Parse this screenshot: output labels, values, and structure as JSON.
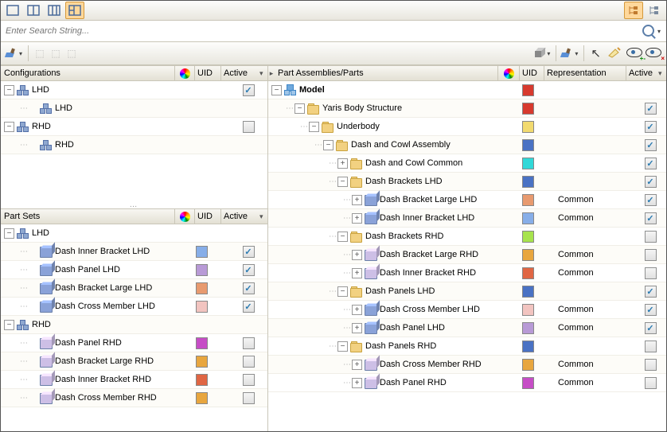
{
  "search": {
    "placeholder": "Enter Search String..."
  },
  "panes": {
    "configs": {
      "title": "Configurations",
      "uid": "UID",
      "active": "Active"
    },
    "partsets": {
      "title": "Part Sets",
      "uid": "UID",
      "active": "Active"
    },
    "assemblies": {
      "title": "Part Assemblies/Parts",
      "uid": "UID",
      "rep": "Representation",
      "active": "Active"
    }
  },
  "configs": [
    {
      "indent": 0,
      "toggle": "minus",
      "icon": "cubes",
      "label": "LHD",
      "checked": true
    },
    {
      "indent": 1,
      "toggle": "none",
      "icon": "cubes",
      "label": "LHD"
    },
    {
      "indent": 0,
      "toggle": "minus",
      "icon": "cubes",
      "label": "RHD",
      "checked": false
    },
    {
      "indent": 1,
      "toggle": "none",
      "icon": "cubes",
      "label": "RHD"
    }
  ],
  "partsets": [
    {
      "indent": 0,
      "toggle": "minus",
      "icon": "cubes",
      "label": "LHD"
    },
    {
      "indent": 1,
      "toggle": "none",
      "icon": "part",
      "pcolor": "#8aa2d8",
      "label": "Dash Inner Bracket LHD",
      "sw": "#87aee8",
      "checked": true
    },
    {
      "indent": 1,
      "toggle": "none",
      "icon": "part",
      "pcolor": "#8aa2d8",
      "label": "Dash Panel LHD",
      "sw": "#b89ad6",
      "checked": true
    },
    {
      "indent": 1,
      "toggle": "none",
      "icon": "part",
      "pcolor": "#8aa2d8",
      "label": "Dash Bracket Large LHD",
      "sw": "#e89a6f",
      "checked": true
    },
    {
      "indent": 1,
      "toggle": "none",
      "icon": "part",
      "pcolor": "#8aa2d8",
      "label": "Dash Cross Member LHD",
      "sw": "#f2c4c0",
      "checked": true
    },
    {
      "indent": 0,
      "toggle": "minus",
      "icon": "cubes",
      "label": "RHD"
    },
    {
      "indent": 1,
      "toggle": "none",
      "icon": "part",
      "pcolor": "#cdbfe6",
      "label": "Dash Panel RHD",
      "sw": "#c64dc6",
      "checked": false
    },
    {
      "indent": 1,
      "toggle": "none",
      "icon": "part",
      "pcolor": "#cdbfe6",
      "label": "Dash Bracket Large RHD",
      "sw": "#e8a63f",
      "checked": false
    },
    {
      "indent": 1,
      "toggle": "none",
      "icon": "part",
      "pcolor": "#cdbfe6",
      "label": "Dash Inner Bracket RHD",
      "sw": "#e06644",
      "checked": false
    },
    {
      "indent": 1,
      "toggle": "none",
      "icon": "part",
      "pcolor": "#cdbfe6",
      "label": "Dash Cross Member RHD",
      "sw": "#e8a63f",
      "checked": false
    }
  ],
  "assemblies": [
    {
      "indent": 0,
      "toggle": "minus",
      "icon": "model",
      "label": "Model",
      "bold": true,
      "sw": "#d73a2e"
    },
    {
      "indent": 1,
      "toggle": "minus",
      "icon": "folder",
      "label": "Yaris Body Structure",
      "sw": "#d73a2e",
      "checked": true
    },
    {
      "indent": 2,
      "toggle": "minus",
      "icon": "folder",
      "label": "Underbody",
      "sw": "#f2da6f",
      "checked": true
    },
    {
      "indent": 3,
      "toggle": "minus",
      "icon": "folder",
      "label": "Dash and Cowl Assembly",
      "sw": "#4a72c4",
      "checked": true
    },
    {
      "indent": 4,
      "toggle": "plus",
      "icon": "folder",
      "label": "Dash and Cowl Common",
      "sw": "#31d8d8",
      "checked": true
    },
    {
      "indent": 4,
      "toggle": "minus",
      "icon": "folder",
      "label": "Dash Brackets LHD",
      "sw": "#4a72c4",
      "checked": true
    },
    {
      "indent": 5,
      "toggle": "plus",
      "icon": "part",
      "pcolor": "#8aa2d8",
      "label": "Dash Bracket Large LHD",
      "sw": "#e89a6f",
      "rep": "Common",
      "checked": true
    },
    {
      "indent": 5,
      "toggle": "plus",
      "icon": "part",
      "pcolor": "#8aa2d8",
      "label": "Dash Inner Bracket LHD",
      "sw": "#87aee8",
      "rep": "Common",
      "checked": true
    },
    {
      "indent": 4,
      "toggle": "minus",
      "icon": "folder",
      "label": "Dash Brackets RHD",
      "sw": "#a7e34d",
      "checked": false
    },
    {
      "indent": 5,
      "toggle": "plus",
      "icon": "part",
      "pcolor": "#cdbfe6",
      "label": "Dash Bracket Large RHD",
      "sw": "#e8a63f",
      "rep": "Common",
      "checked": false
    },
    {
      "indent": 5,
      "toggle": "plus",
      "icon": "part",
      "pcolor": "#cdbfe6",
      "label": "Dash Inner Bracket RHD",
      "sw": "#e06644",
      "rep": "Common",
      "checked": false
    },
    {
      "indent": 4,
      "toggle": "minus",
      "icon": "folder",
      "label": "Dash Panels LHD",
      "sw": "#4a72c4",
      "checked": true
    },
    {
      "indent": 5,
      "toggle": "plus",
      "icon": "part",
      "pcolor": "#8aa2d8",
      "label": "Dash Cross Member LHD",
      "sw": "#f2c4c0",
      "rep": "Common",
      "checked": true
    },
    {
      "indent": 5,
      "toggle": "plus",
      "icon": "part",
      "pcolor": "#8aa2d8",
      "label": "Dash Panel LHD",
      "sw": "#b89ad6",
      "rep": "Common",
      "checked": true
    },
    {
      "indent": 4,
      "toggle": "minus",
      "icon": "folder",
      "label": "Dash Panels RHD",
      "sw": "#4a72c4",
      "checked": false
    },
    {
      "indent": 5,
      "toggle": "plus",
      "icon": "part",
      "pcolor": "#cdbfe6",
      "label": "Dash Cross Member RHD",
      "sw": "#e8a63f",
      "rep": "Common",
      "checked": false
    },
    {
      "indent": 5,
      "toggle": "plus",
      "icon": "part",
      "pcolor": "#cdbfe6",
      "label": "Dash Panel RHD",
      "sw": "#c64dc6",
      "rep": "Common",
      "checked": false
    }
  ]
}
